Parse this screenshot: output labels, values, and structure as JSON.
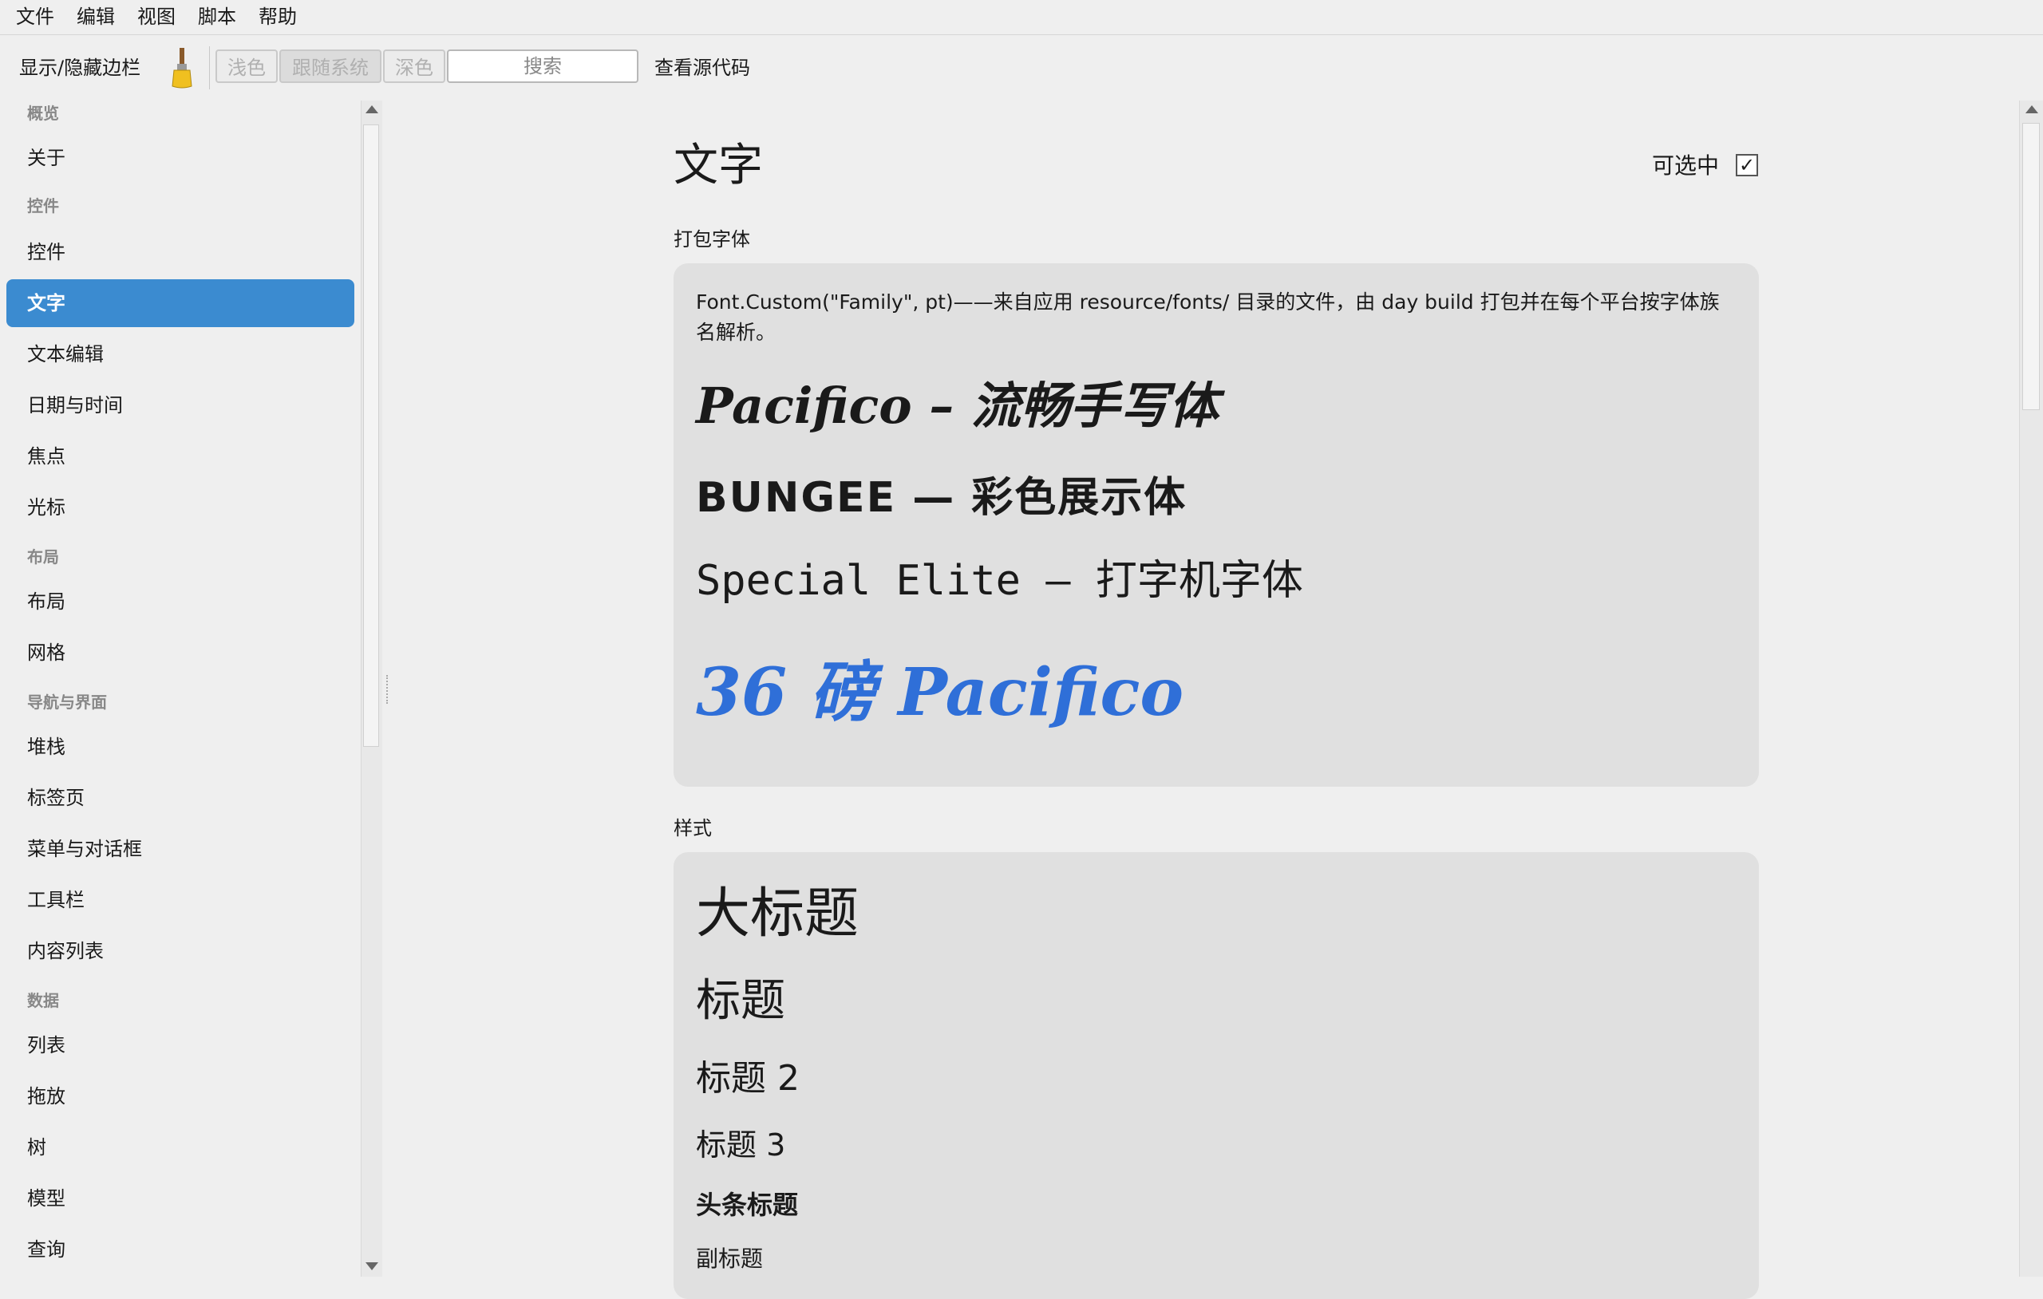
{
  "menu": [
    "文件",
    "编辑",
    "视图",
    "脚本",
    "帮助"
  ],
  "toolbar": {
    "toggle_sidebar": "显示/隐藏边栏",
    "theme_light": "浅色",
    "theme_system": "跟随系统",
    "theme_dark": "深色",
    "search_placeholder": "搜索",
    "view_source": "查看源代码"
  },
  "sidebar": {
    "groups": [
      "概览",
      "控件",
      "布局",
      "导航与界面",
      "数据"
    ],
    "items": {
      "about": "关于",
      "widgets": "控件",
      "text": "文字",
      "text_edit": "文本编辑",
      "datetime": "日期与时间",
      "focus": "焦点",
      "cursor": "光标",
      "layout": "布局",
      "grid": "网格",
      "stack": "堆栈",
      "tabs": "标签页",
      "menus_dialogs": "菜单与对话框",
      "toolbar": "工具栏",
      "content_list": "内容列表",
      "list": "列表",
      "drag_drop": "拖放",
      "tree": "树",
      "model": "模型",
      "query": "查询"
    },
    "selected": "文字"
  },
  "content": {
    "title": "文字",
    "selectable_label": "可选中",
    "selectable_checked": true,
    "checkmark": "✓",
    "bundled_fonts": {
      "label": "打包字体",
      "description": "Font.Custom(\"Family\", pt)——来自应用 resource/fonts/ 目录的文件，由 day build 打包并在每个平台按字体族名解析。",
      "samples": {
        "pacifico": "Pacifico – 流畅手写体",
        "bungee": "BUNGEE — 彩色展示体",
        "special_elite": "Special Elite — 打字机字体",
        "big": "36 磅 Pacifico"
      },
      "accent_color": "#2f6fd8"
    },
    "styles": {
      "label": "样式",
      "large_title": "大标题",
      "title1": "标题",
      "title2": "标题 2",
      "title3": "标题 3",
      "headline": "头条标题",
      "subheadline": "副标题"
    }
  }
}
